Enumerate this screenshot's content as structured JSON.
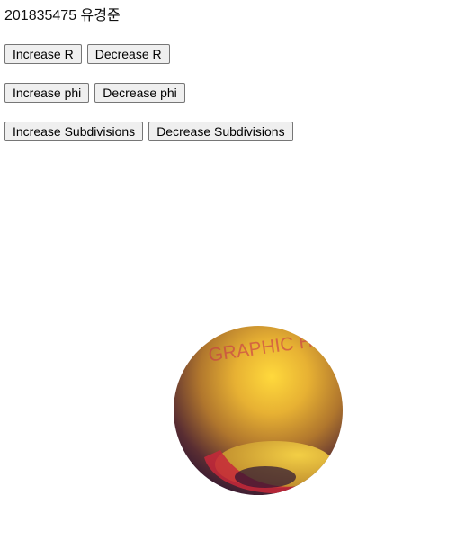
{
  "page": {
    "title": "201835475 유경준"
  },
  "controls": {
    "increase_r": "Increase R",
    "decrease_r": "Decrease R",
    "increase_phi": "Increase phi",
    "decrease_phi": "Decrease phi",
    "increase_subdivisions": "Increase Subdivisions",
    "decrease_subdivisions": "Decrease Subdivisions"
  },
  "scene": {
    "texture_text": "GRAPHIC HONG KONG",
    "colors": {
      "highlight": "#fbd23a",
      "mid": "#c8912e",
      "shadow": "#2a1233",
      "accent_red": "#c7283a",
      "band_gold": "#e8b230"
    }
  }
}
